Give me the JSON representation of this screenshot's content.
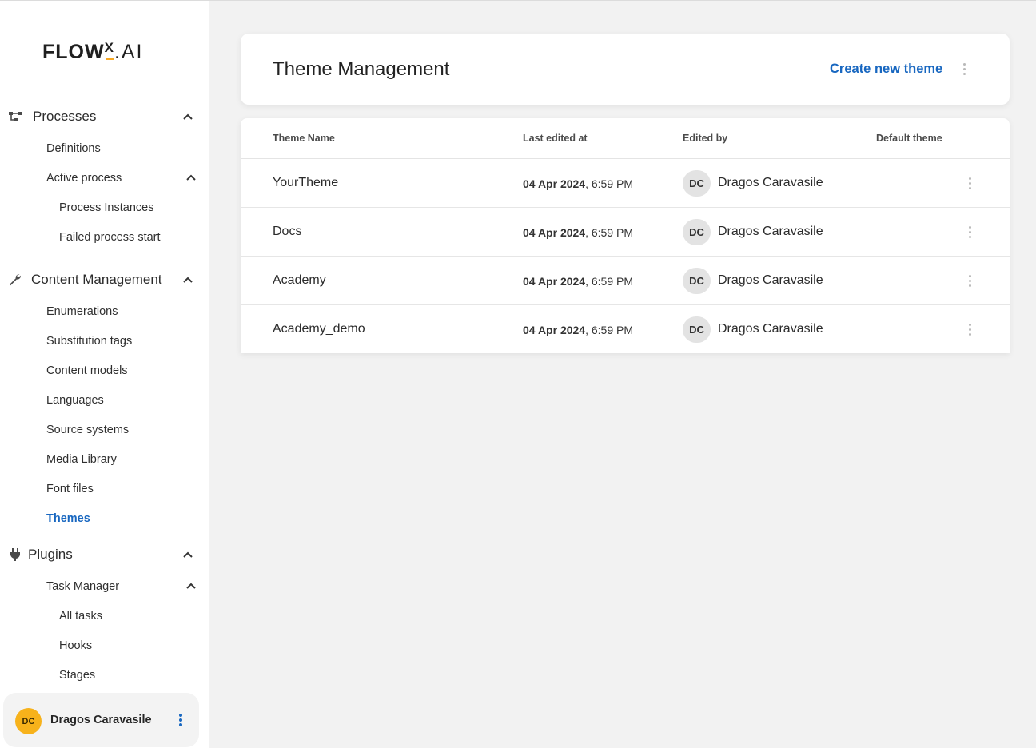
{
  "brand": {
    "name": "FLOW",
    "mark": "X",
    "suffix": ".AI",
    "accent": "#f7a823"
  },
  "sidebar": {
    "sections": [
      {
        "label": "Processes",
        "icon": "flow-icon",
        "items": [
          {
            "label": "Definitions"
          },
          {
            "label": "Active process",
            "expanded": true,
            "children": [
              "Process Instances",
              "Failed process start"
            ]
          }
        ]
      },
      {
        "label": "Content Management",
        "icon": "wrench-icon",
        "items": [
          {
            "label": "Enumerations"
          },
          {
            "label": "Substitution tags"
          },
          {
            "label": "Content models"
          },
          {
            "label": "Languages"
          },
          {
            "label": "Source systems"
          },
          {
            "label": "Media Library"
          },
          {
            "label": "Font files"
          },
          {
            "label": "Themes",
            "active": true
          }
        ]
      },
      {
        "label": "Plugins",
        "icon": "plug-icon",
        "items": [
          {
            "label": "Task Manager",
            "expanded": true,
            "children": [
              "All tasks",
              "Hooks",
              "Stages"
            ]
          }
        ]
      }
    ],
    "user": {
      "initials": "DC",
      "name": "Dragos Caravasile"
    }
  },
  "header": {
    "title": "Theme Management",
    "create_label": "Create new theme"
  },
  "table": {
    "columns": [
      "Theme Name",
      "Last edited at",
      "Edited by",
      "Default theme"
    ],
    "rows": [
      {
        "name": "YourTheme",
        "date": "04 Apr 2024",
        "time": ", 6:59 PM",
        "initials": "DC",
        "editor": "Dragos Caravasile"
      },
      {
        "name": "Docs",
        "date": "04 Apr 2024",
        "time": ", 6:59 PM",
        "initials": "DC",
        "editor": "Dragos Caravasile"
      },
      {
        "name": "Academy",
        "date": "04 Apr 2024",
        "time": ", 6:59 PM",
        "initials": "DC",
        "editor": "Dragos Caravasile"
      },
      {
        "name": "Academy_demo",
        "date": "04 Apr 2024",
        "time": ", 6:59 PM",
        "initials": "DC",
        "editor": "Dragos Caravasile"
      }
    ]
  },
  "colors": {
    "accent_blue": "#1867c0",
    "avatar_orange": "#f7b21b",
    "background": "#f2f2f2"
  }
}
